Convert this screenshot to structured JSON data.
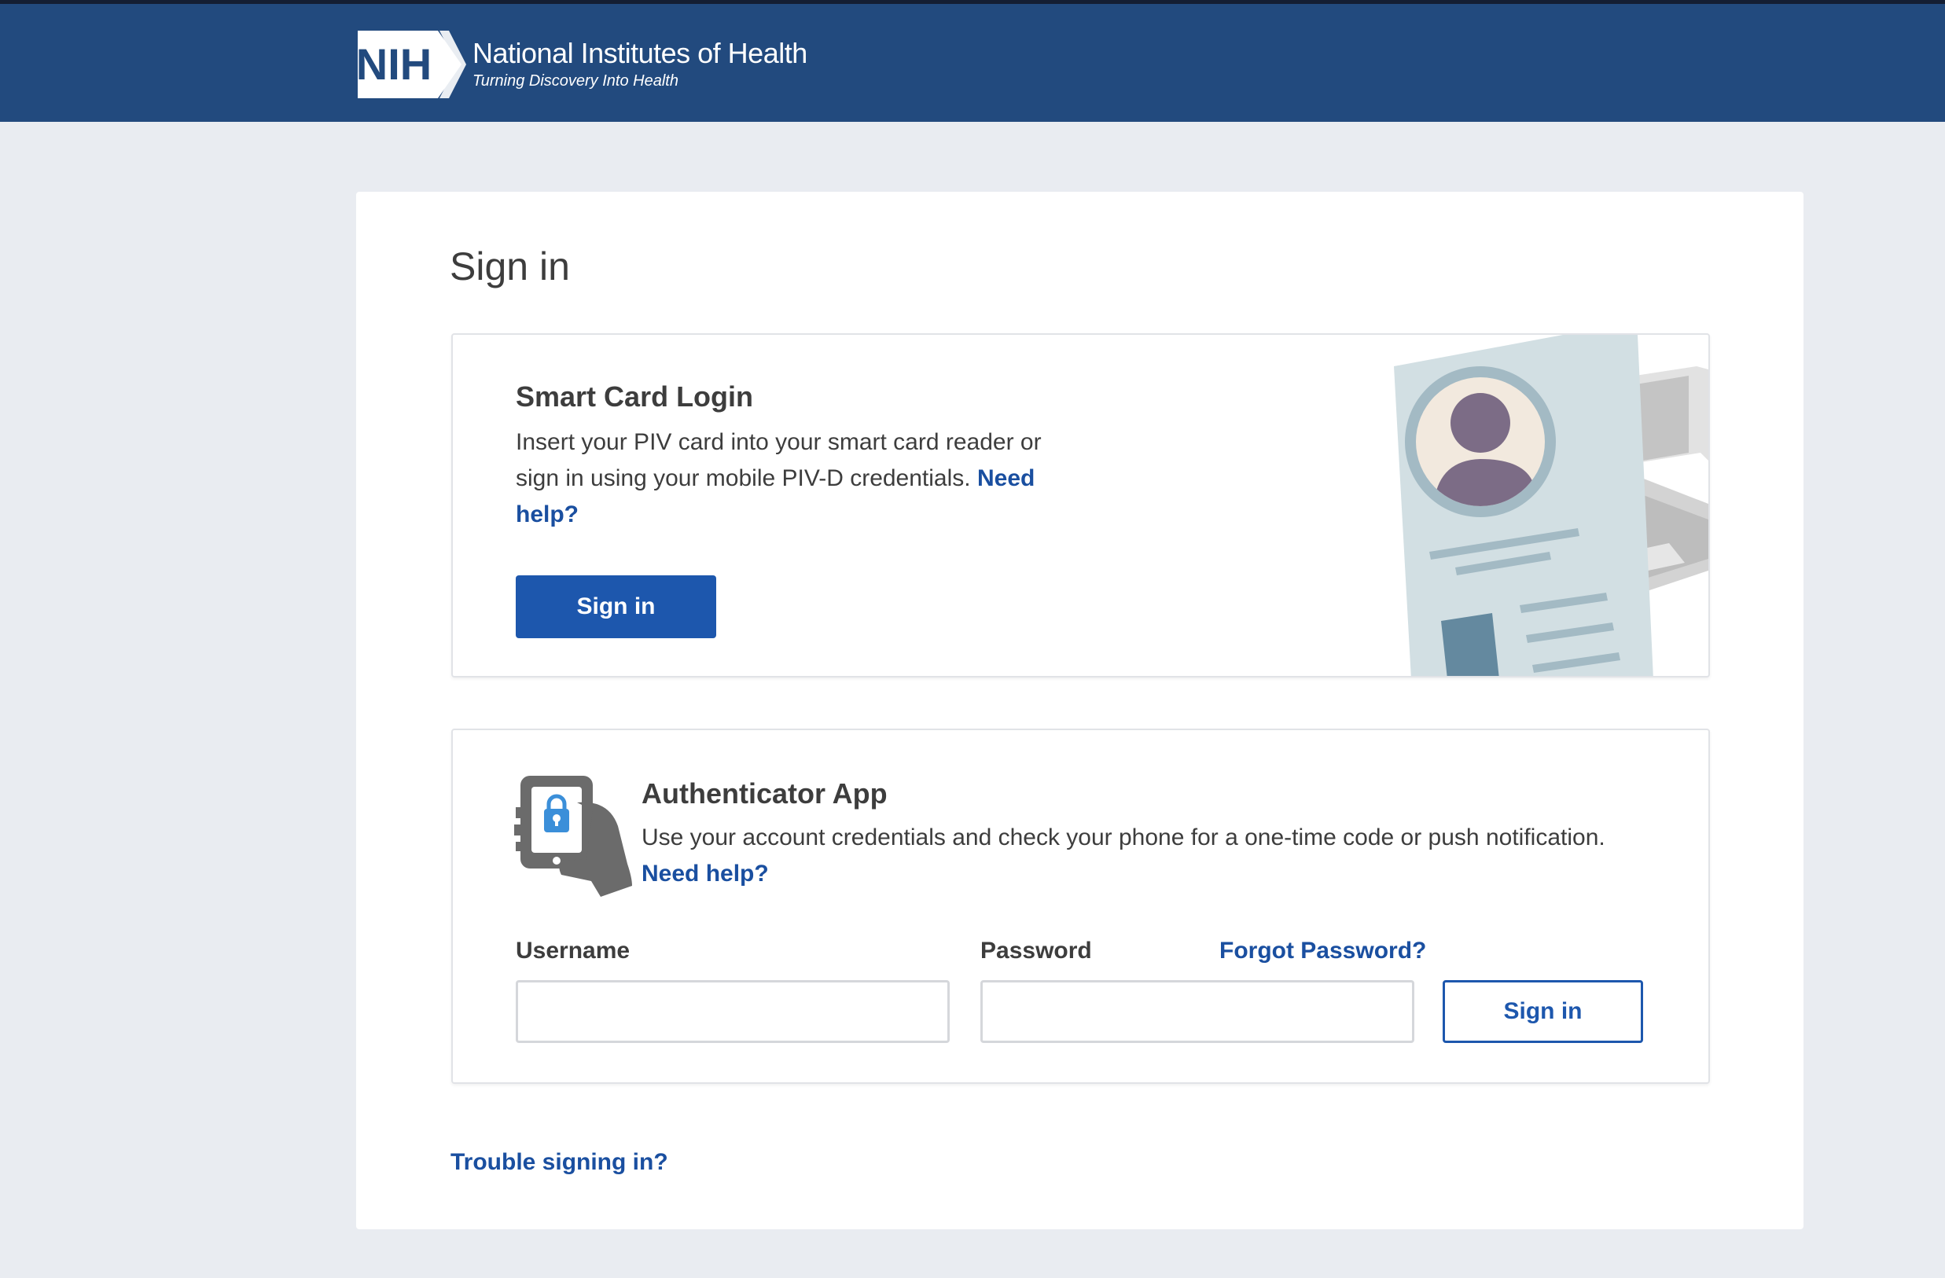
{
  "header": {
    "logo_abbrev": "NIH",
    "title": "National Institutes of Health",
    "tagline": "Turning Discovery Into Health"
  },
  "page": {
    "title": "Sign in"
  },
  "smart_card": {
    "title": "Smart Card Login",
    "description": "Insert your PIV card into your smart card reader or sign in using your mobile PIV-D credentials.",
    "help_link": "Need help?",
    "sign_in_label": "Sign in",
    "illustration_icon": "id-card-illustration"
  },
  "authenticator": {
    "title": "Authenticator App",
    "description": "Use your account credentials and check your phone for a one-time code or push notification.",
    "help_link": "Need help?",
    "icon": "phone-lock-icon",
    "username_label": "Username",
    "username_value": "",
    "password_label": "Password",
    "password_value": "",
    "forgot_link": "Forgot Password?",
    "sign_in_label": "Sign in"
  },
  "footer": {
    "trouble_link": "Trouble signing in?"
  },
  "colors": {
    "header_bg": "#224a7e",
    "page_bg": "#e9ecf1",
    "primary": "#1d57ad",
    "link": "#1a4fa0"
  }
}
